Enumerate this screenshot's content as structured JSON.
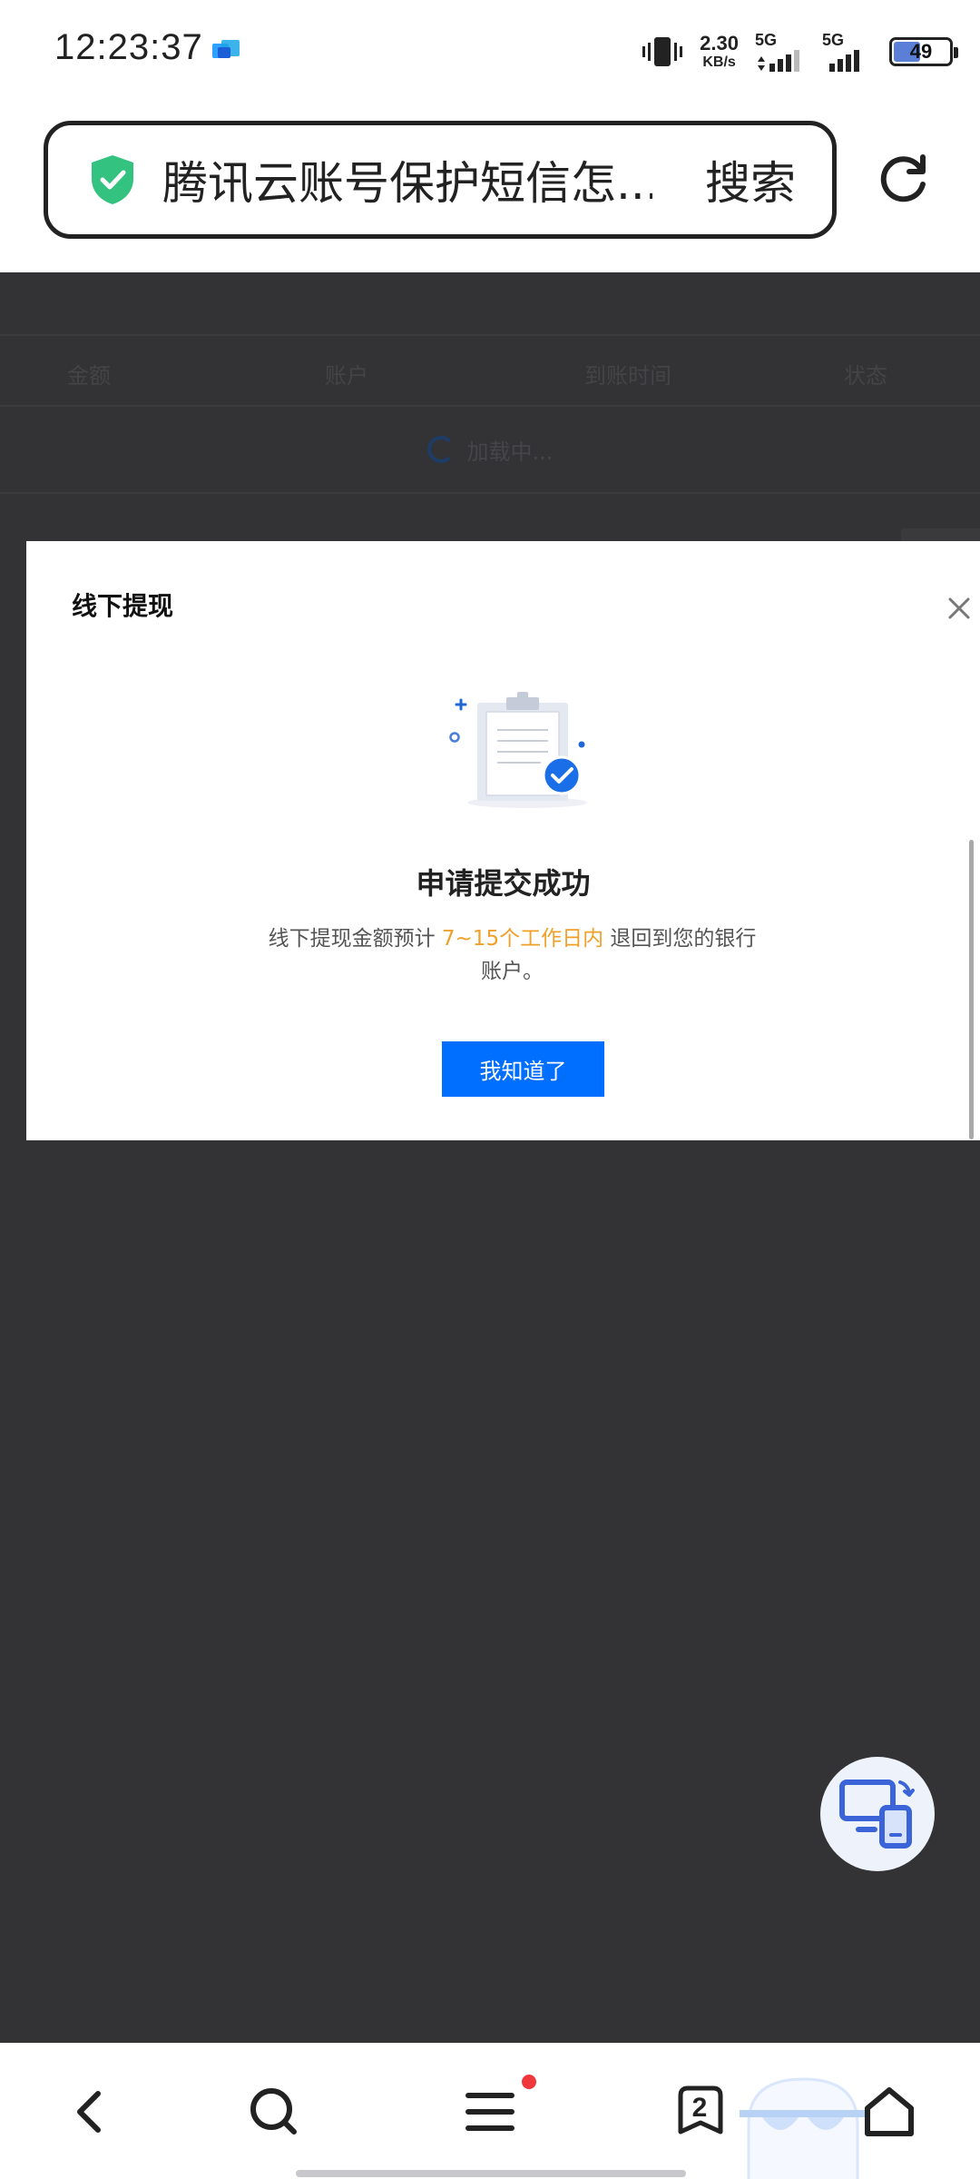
{
  "status_bar": {
    "time": "12:23:37",
    "net_speed_value": "2.30",
    "net_speed_unit": "KB/s",
    "sim1_label": "5G",
    "sim2_label": "5G",
    "battery_level": "49"
  },
  "address_bar": {
    "text": "腾讯云账号保护短信怎...",
    "search_label": "搜索"
  },
  "table": {
    "headers": [
      "金额",
      "账户",
      "到账时间",
      "状态"
    ],
    "loading_text": "加载中..."
  },
  "modal": {
    "title": "线下提现",
    "success_title": "申请提交成功",
    "desc_prefix": "线下提现金额预计",
    "desc_highlight": "7~15个工作日内",
    "desc_suffix": "退回到您的银行账户。",
    "ok_label": "我知道了"
  },
  "bottom_nav": {
    "tabs_count": "2"
  },
  "colors": {
    "accent": "#006eff",
    "highlight": "#f0a02a",
    "overlay": "#333335"
  }
}
